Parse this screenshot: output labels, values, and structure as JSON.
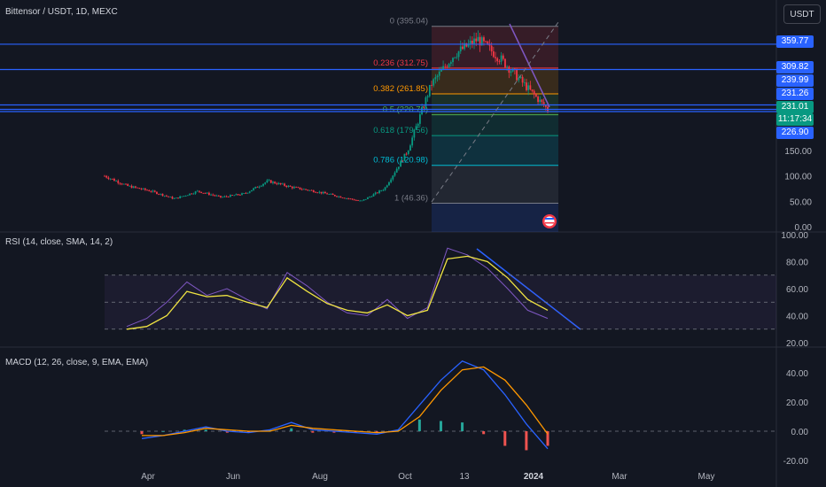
{
  "header": {
    "title": "Bittensor / USDT, 1D, MEXC",
    "currency_button": "USDT"
  },
  "price_tags": [
    {
      "label": "359.77",
      "value": 359.77,
      "color": "#2962ff"
    },
    {
      "label": "309.82",
      "value": 309.82,
      "color": "#2962ff"
    },
    {
      "label": "239.99",
      "value": 239.99,
      "color": "#2962ff"
    },
    {
      "label": "231.26",
      "value": 231.26,
      "color": "#2962ff"
    },
    {
      "label": "231.01",
      "value": 231.01,
      "color": "#089981"
    },
    {
      "label": "11:17:34",
      "value": 231.01,
      "color": "#089981"
    },
    {
      "label": "226.90",
      "value": 226.9,
      "color": "#2962ff"
    }
  ],
  "chart_data": [
    {
      "type": "candlestick",
      "title": "Bittensor / USDT, 1D, MEXC",
      "x_tick_labels": [
        "Apr",
        "Jun",
        "Aug",
        "Oct",
        "13",
        "2024",
        "Mar",
        "May"
      ],
      "y_tick_labels": [
        "0.00",
        "50.00",
        "100.00",
        "150.00"
      ],
      "ylim": [
        0,
        400
      ],
      "approx_close_series": {
        "x": [
          "Mar 28",
          "Apr 15",
          "May 1",
          "May 20",
          "Jun 1",
          "Jun 20",
          "Jul 10",
          "Aug 1",
          "Aug 15",
          "Sep 1",
          "Sep 20",
          "Oct 10",
          "Oct 25",
          "Nov 5",
          "Nov 15",
          "Nov 25",
          "Dec 5",
          "Dec 15",
          "Dec 25",
          "Jan 3"
        ],
        "values": [
          100,
          80,
          70,
          55,
          70,
          58,
          65,
          90,
          78,
          70,
          60,
          50,
          75,
          150,
          280,
          340,
          370,
          330,
          280,
          231
        ]
      },
      "horizontal_levels": [
        359.77,
        309.82,
        239.99,
        231.26,
        226.9
      ],
      "fibonacci": [
        {
          "label": "0 (395.04)",
          "ratio": 0,
          "price": 395.04,
          "color": "#787b86"
        },
        {
          "label": "0.236 (312.75)",
          "ratio": 0.236,
          "price": 312.75,
          "color": "#f23645"
        },
        {
          "label": "0.382 (261.85)",
          "ratio": 0.382,
          "price": 261.85,
          "color": "#ff9800"
        },
        {
          "label": "0.5 (220.70)",
          "ratio": 0.5,
          "price": 220.7,
          "color": "#4caf50"
        },
        {
          "label": "0.618 (179.56)",
          "ratio": 0.618,
          "price": 179.56,
          "color": "#089981"
        },
        {
          "label": "0.786 (120.98)",
          "ratio": 0.786,
          "price": 120.98,
          "color": "#00bcd4"
        },
        {
          "label": "1 (46.36)",
          "ratio": 1,
          "price": 46.36,
          "color": "#787b86"
        }
      ]
    },
    {
      "type": "line",
      "title": "RSI (14, close, SMA, 14, 2)",
      "y_tick_labels": [
        "100.00",
        "80.00",
        "60.00",
        "40.00",
        "20.00"
      ],
      "ylim": [
        20,
        100
      ],
      "bands": [
        70,
        50,
        30
      ],
      "series": [
        {
          "values": [
            32,
            38,
            50,
            65,
            55,
            60,
            52,
            45,
            72,
            62,
            50,
            42,
            40,
            52,
            38,
            46,
            90,
            85,
            75,
            60,
            44,
            38
          ],
          "color": "#7e57c2"
        },
        {
          "values": [
            30,
            32,
            40,
            58,
            54,
            55,
            50,
            46,
            68,
            58,
            49,
            44,
            42,
            48,
            40,
            44,
            82,
            84,
            80,
            68,
            52,
            44
          ],
          "color": "#f0e442"
        }
      ]
    },
    {
      "type": "bar",
      "title": "MACD (12, 26, close, 9, EMA, EMA)",
      "y_tick_labels": [
        "40.00",
        "20.00",
        "0.00",
        "-20.00"
      ],
      "ylim": [
        -25,
        50
      ],
      "series": [
        {
          "values": [
            -5,
            -3,
            0,
            3,
            0,
            -1,
            1,
            6,
            1,
            0,
            -1,
            -2,
            1,
            18,
            35,
            48,
            42,
            25,
            5,
            -12
          ],
          "color": "#2962ff"
        },
        {
          "values": [
            -3,
            -3,
            -1,
            2,
            1,
            0,
            0,
            4,
            2,
            1,
            0,
            -1,
            0,
            10,
            28,
            42,
            44,
            35,
            18,
            -2
          ],
          "color": "#ff9800"
        },
        {
          "values": [
            -2,
            0,
            1,
            1,
            -1,
            -1,
            1,
            2,
            -1,
            -1,
            -1,
            -1,
            1,
            8,
            7,
            6,
            -2,
            -10,
            -13,
            -10
          ]
        }
      ]
    }
  ]
}
